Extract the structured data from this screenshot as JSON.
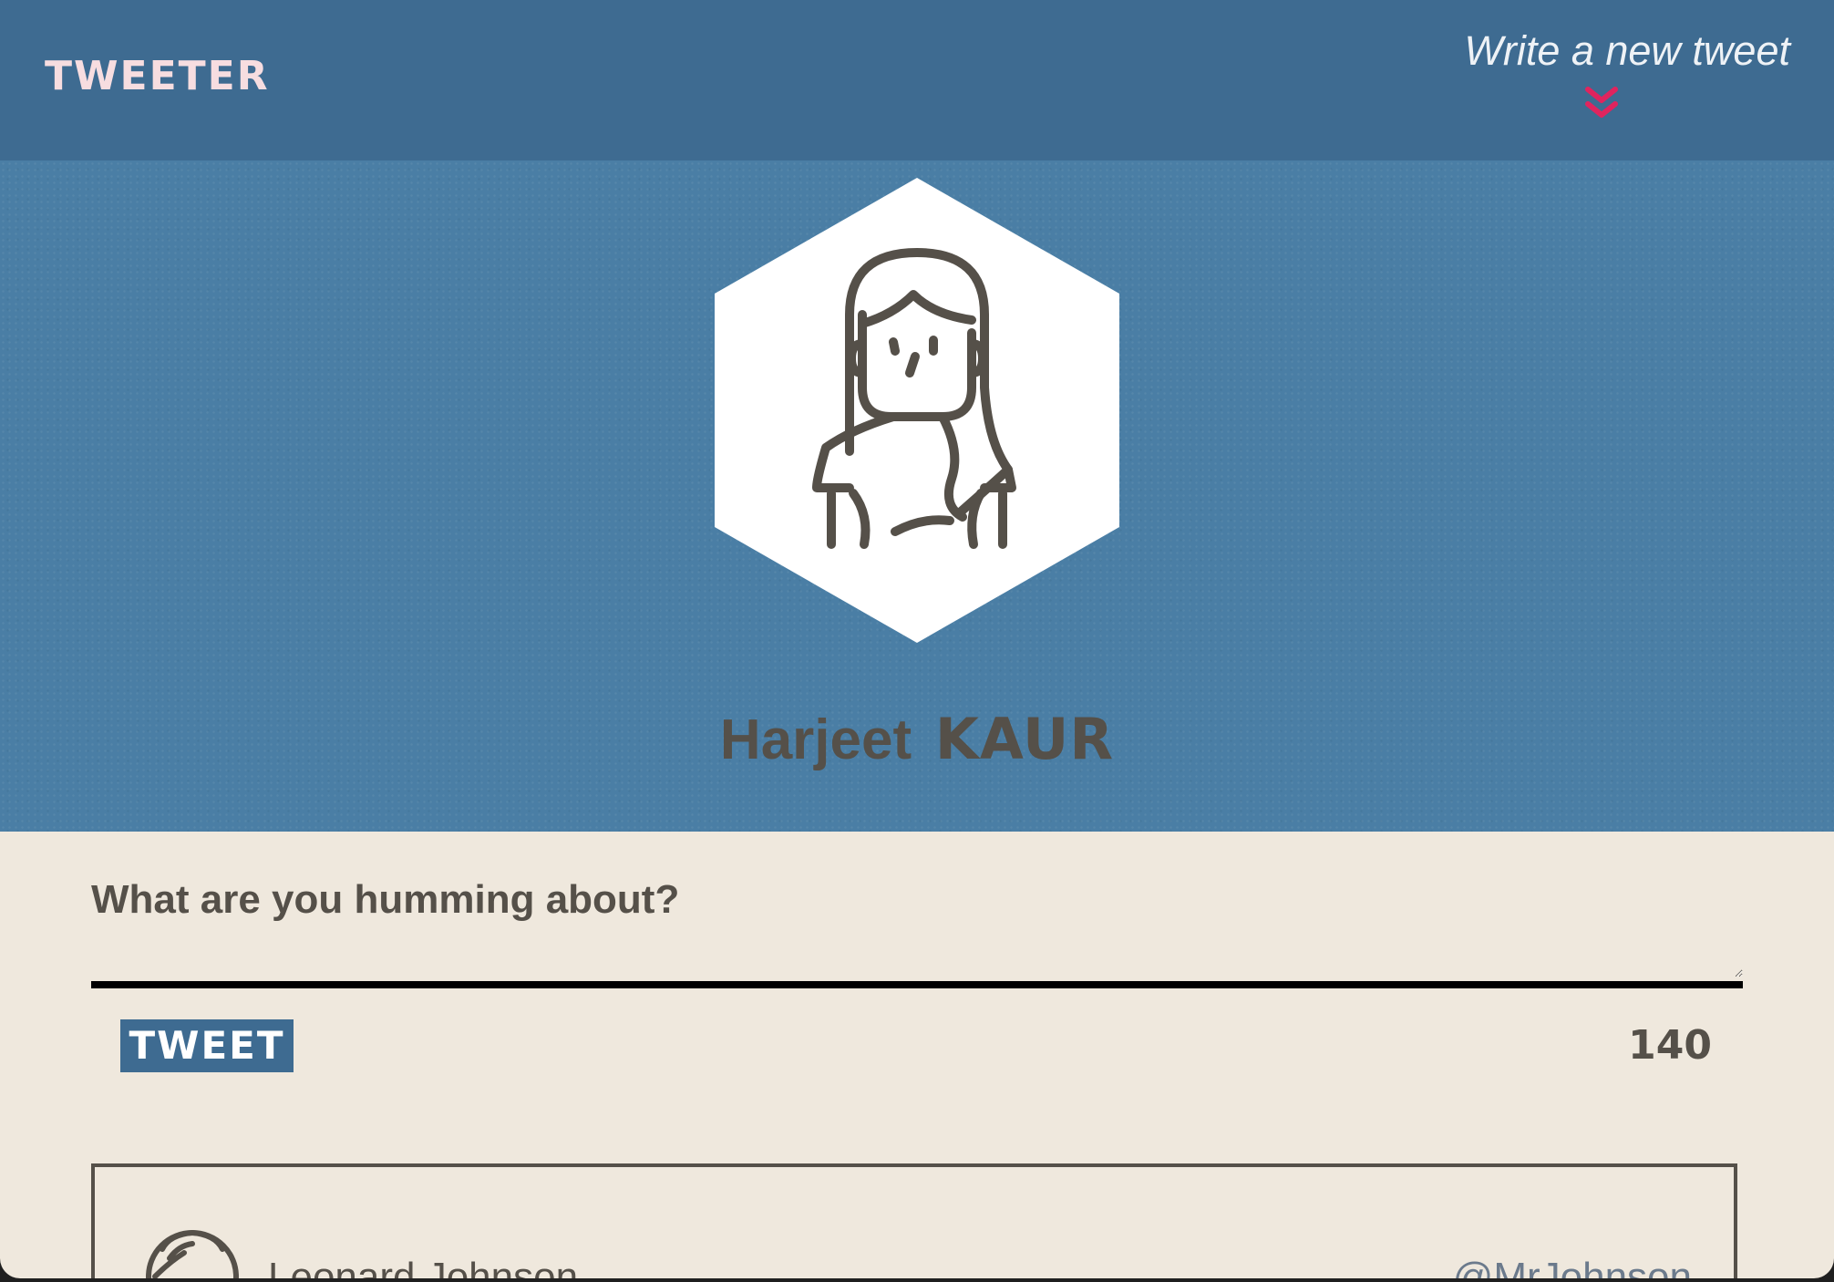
{
  "nav": {
    "brand": "TWEETER",
    "compose_link": "Write a new tweet",
    "chevron_color": "#e0245e",
    "icon": "double-chevron-down-icon"
  },
  "profile": {
    "first_name": "Harjeet",
    "last_name": "KAUR",
    "avatar_icon": "woman-avatar-icon"
  },
  "compose": {
    "prompt": "What are you humming about?",
    "button_label": "TWEET",
    "char_count": "140"
  },
  "tweets": [
    {
      "name": "Leonard Johnson",
      "handle": "@MrJohnson",
      "avatar_icon": "user-avatar-icon"
    }
  ],
  "colors": {
    "nav_bg": "#3e6b91",
    "header_bg": "#4a7ea5",
    "page_bg": "#efe8dd",
    "text": "#555049",
    "accent": "#e0245e"
  }
}
